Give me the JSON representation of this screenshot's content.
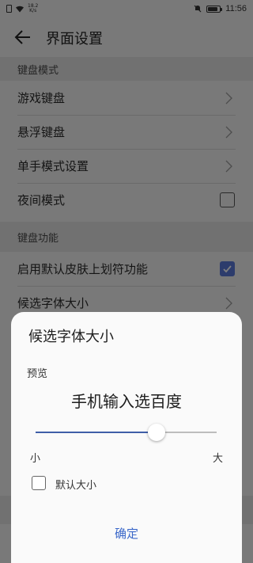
{
  "status_bar": {
    "network_speed": "18.2\nK/s",
    "time": "11:56"
  },
  "header": {
    "title": "界面设置"
  },
  "sections": [
    {
      "title": "键盘模式",
      "items": [
        {
          "label": "游戏键盘",
          "control": "chevron"
        },
        {
          "label": "悬浮键盘",
          "control": "chevron"
        },
        {
          "label": "单手模式设置",
          "control": "chevron"
        },
        {
          "label": "夜间模式",
          "control": "checkbox",
          "checked": false
        }
      ]
    },
    {
      "title": "键盘功能",
      "items": [
        {
          "label": "启用默认皮肤上划符功能",
          "control": "checkbox",
          "checked": true
        },
        {
          "label": "候选字体大小",
          "control": "chevron"
        }
      ]
    }
  ],
  "dialog": {
    "title": "候选字体大小",
    "preview_label": "预览",
    "preview_text": "手机输入选百度",
    "slider": {
      "value_fraction": 0.67
    },
    "min_label": "小",
    "max_label": "大",
    "default_size": {
      "label": "默认大小",
      "checked": false
    },
    "confirm_label": "确定"
  },
  "colors": {
    "accent": "#3b68c9",
    "checkbox_checked": "#5b79d9",
    "slider_fill": "#3f5fa8"
  }
}
